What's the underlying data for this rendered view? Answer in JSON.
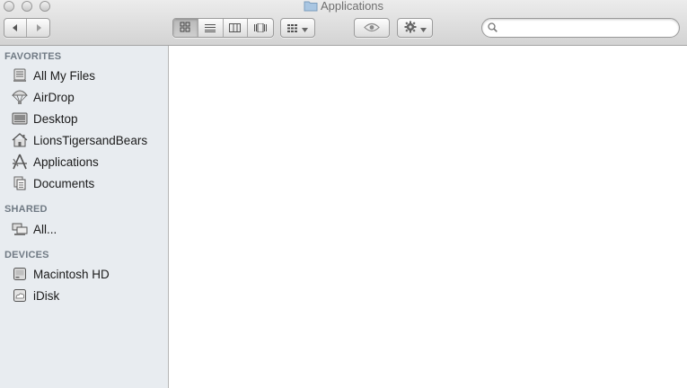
{
  "window": {
    "title": "Applications"
  },
  "toolbar": {
    "search": {
      "value": "",
      "placeholder": ""
    }
  },
  "sidebar": {
    "favorites": {
      "header": "FAVORITES",
      "items": [
        {
          "label": "All My Files",
          "icon": "all-my-files-icon"
        },
        {
          "label": "AirDrop",
          "icon": "airdrop-icon"
        },
        {
          "label": "Desktop",
          "icon": "desktop-icon"
        },
        {
          "label": "LionsTigersandBears",
          "icon": "home-icon"
        },
        {
          "label": "Applications",
          "icon": "applications-icon"
        },
        {
          "label": "Documents",
          "icon": "documents-icon"
        }
      ]
    },
    "shared": {
      "header": "SHARED",
      "items": [
        {
          "label": "All...",
          "icon": "network-icon"
        }
      ]
    },
    "devices": {
      "header": "DEVICES",
      "items": [
        {
          "label": "Macintosh HD",
          "icon": "hard-drive-icon"
        },
        {
          "label": "iDisk",
          "icon": "idisk-icon"
        }
      ]
    }
  }
}
